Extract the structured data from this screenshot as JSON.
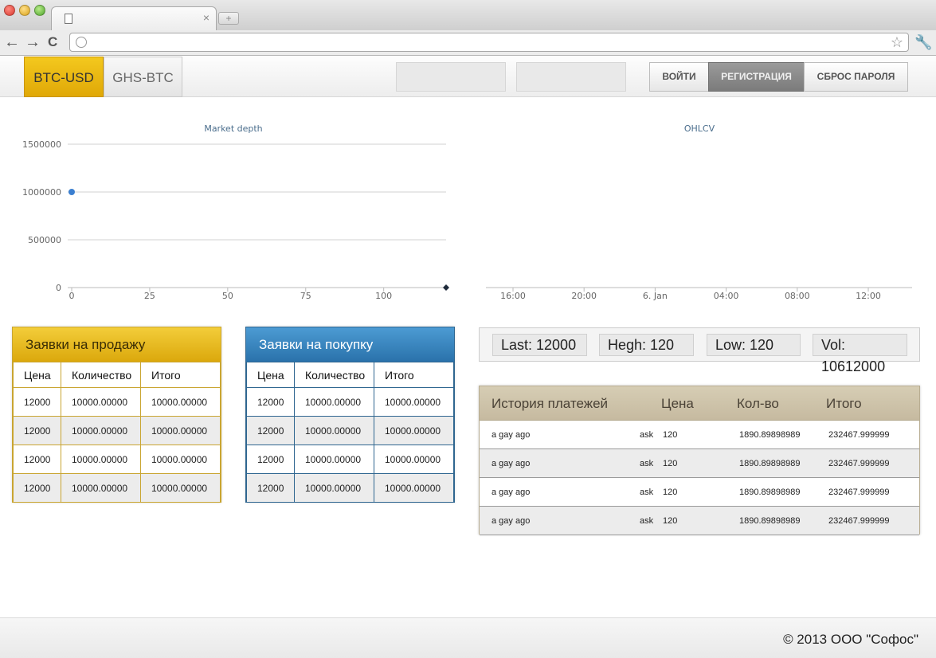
{
  "browser": {
    "tab_close": "×",
    "newtab_label": "+",
    "back": "←",
    "forward": "→",
    "reload": "C",
    "star": "☆",
    "wrench": "🔧"
  },
  "header": {
    "pairs": [
      "BTC-USD",
      "GHS-BTC"
    ],
    "login_label": "ВОЙТИ",
    "register_label": "РЕГИСТРАЦИЯ",
    "reset_label": "СБРОС ПАРОЛЯ"
  },
  "chart_data": [
    {
      "type": "scatter",
      "title": "Market depth",
      "x_ticks": [
        0,
        25,
        50,
        75,
        100
      ],
      "y_ticks": [
        0,
        500000,
        1000000,
        1500000
      ],
      "y_tick_labels": [
        "0",
        "500000",
        "1000000",
        "1500000"
      ],
      "xlim": [
        0,
        120
      ],
      "ylim": [
        0,
        1500000
      ],
      "series": [
        {
          "color": "#3b7fd0",
          "marker": "circle",
          "points": [
            [
              0,
              1000000
            ]
          ]
        },
        {
          "color": "#1e2b3b",
          "marker": "diamond",
          "points": [
            [
              120,
              0
            ]
          ]
        }
      ]
    },
    {
      "type": "line",
      "title": "OHLCV",
      "x_tick_labels": [
        "16:00",
        "20:00",
        "6. Jan",
        "04:00",
        "08:00",
        "12:00"
      ],
      "series": []
    }
  ],
  "sell_book": {
    "title": "Заявки на продажу",
    "headers": [
      "Цена",
      "Количество",
      "Итого"
    ],
    "rows": [
      [
        "12000",
        "10000.00000",
        "10000.00000"
      ],
      [
        "12000",
        "10000.00000",
        "10000.00000"
      ],
      [
        "12000",
        "10000.00000",
        "10000.00000"
      ],
      [
        "12000",
        "10000.00000",
        "10000.00000"
      ]
    ]
  },
  "buy_book": {
    "title": "Заявки на покупку",
    "headers": [
      "Цена",
      "Количество",
      "Итого"
    ],
    "rows": [
      [
        "12000",
        "10000.00000",
        "10000.00000"
      ],
      [
        "12000",
        "10000.00000",
        "10000.00000"
      ],
      [
        "12000",
        "10000.00000",
        "10000.00000"
      ],
      [
        "12000",
        "10000.00000",
        "10000.00000"
      ]
    ]
  },
  "stats": {
    "last": "Last: 12000",
    "high": "Hegh: 120",
    "low": "Low: 120",
    "vol": "Vol: 10612000"
  },
  "history": {
    "headers": [
      "История платежей",
      "Цена",
      "Кол-во",
      "Итого"
    ],
    "rows": [
      [
        "a gay ago",
        "ask",
        "120",
        "1890.89898989",
        "232467.999999"
      ],
      [
        "a gay ago",
        "ask",
        "120",
        "1890.89898989",
        "232467.999999"
      ],
      [
        "a gay ago",
        "ask",
        "120",
        "1890.89898989",
        "232467.999999"
      ],
      [
        "a gay ago",
        "ask",
        "120",
        "1890.89898989",
        "232467.999999"
      ]
    ]
  },
  "footer": {
    "copyright": "© 2013 ООО \"Софос\""
  }
}
